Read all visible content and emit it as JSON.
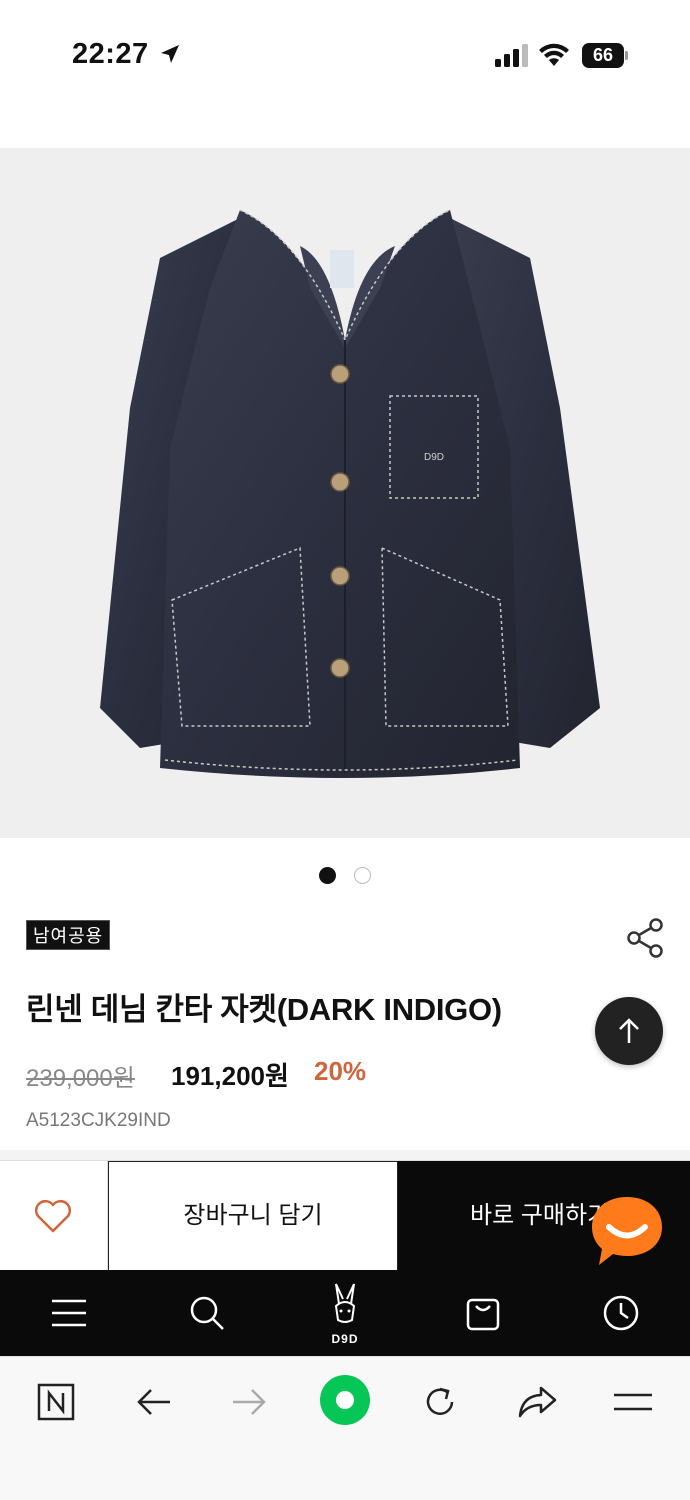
{
  "status_bar": {
    "time": "22:27",
    "battery": "66"
  },
  "product": {
    "image_alt": "linen denim canta jacket dark indigo",
    "pager": {
      "current": 1,
      "total": 2
    },
    "gender_tag": "남여공용",
    "title": "린넨 데님 칸타 자켓(DARK INDIGO)",
    "original_price": "239,000원",
    "sale_price": "191,200원",
    "discount": "20%",
    "code": "A5123CJK29IND",
    "brand_logo_text": "D9D"
  },
  "action_bar": {
    "cart_label": "장바구니 담기",
    "buy_label": "바로 구매하기"
  },
  "colors": {
    "discount": "#d2643c",
    "wishlist_heart": "#d2643c",
    "chat_button": "#ff7a1a",
    "browser_home": "#06c755"
  },
  "app_nav": {
    "items": [
      "menu-icon",
      "search-icon",
      "brand-logo",
      "shopping-bag-icon",
      "recent-clock-icon"
    ]
  },
  "browser_toolbar": {
    "items": [
      "naver-n-icon",
      "back-arrow-icon",
      "forward-arrow-icon",
      "green-home-icon",
      "reload-icon",
      "share-icon",
      "menu-icon"
    ]
  }
}
